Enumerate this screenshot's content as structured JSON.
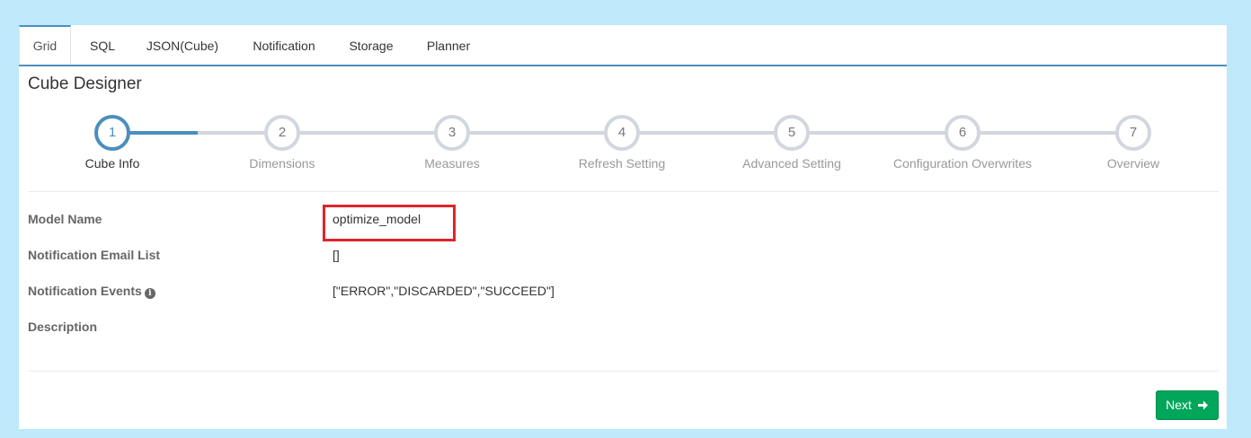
{
  "tabs": [
    {
      "label": "Grid",
      "active": true
    },
    {
      "label": "SQL"
    },
    {
      "label": "JSON(Cube)"
    },
    {
      "label": "Notification"
    },
    {
      "label": "Storage"
    },
    {
      "label": "Planner"
    }
  ],
  "title": "Cube Designer",
  "steps": [
    {
      "num": "1",
      "label": "Cube Info",
      "active": true
    },
    {
      "num": "2",
      "label": "Dimensions"
    },
    {
      "num": "3",
      "label": "Measures"
    },
    {
      "num": "4",
      "label": "Refresh Setting"
    },
    {
      "num": "5",
      "label": "Advanced Setting"
    },
    {
      "num": "6",
      "label": "Configuration Overwrites"
    },
    {
      "num": "7",
      "label": "Overview"
    }
  ],
  "fields": {
    "model_name": {
      "label": "Model Name",
      "value": "optimize_model"
    },
    "email_list": {
      "label": "Notification Email List",
      "value": "[]"
    },
    "events": {
      "label": "Notification Events",
      "value": "[\"ERROR\",\"DISCARDED\",\"SUCCEED\"]"
    },
    "description": {
      "label": "Description",
      "value": ""
    }
  },
  "buttons": {
    "next": "Next"
  },
  "colors": {
    "accent": "#4a8fbe",
    "success": "#00a65a",
    "highlight": "#e0242b",
    "background": "#bde9fb"
  },
  "icons": {
    "info": "info-circle-icon",
    "next": "arrow-right-icon"
  }
}
